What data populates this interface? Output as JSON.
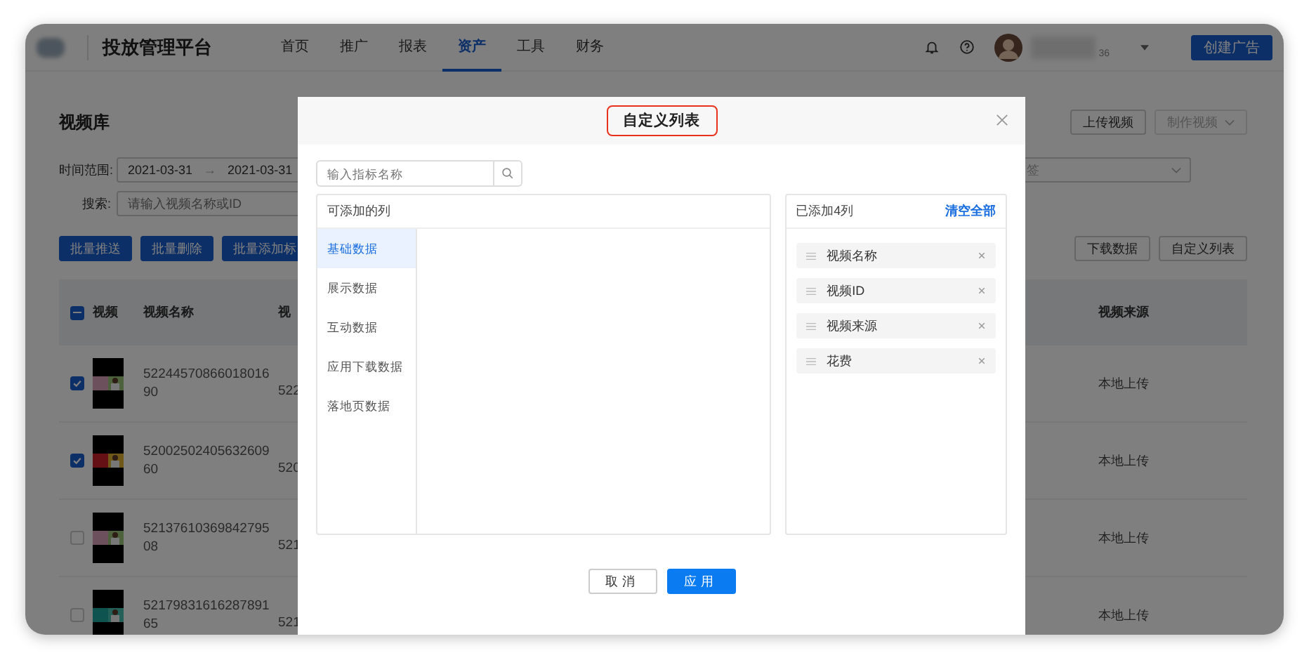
{
  "top_nav": {
    "app_title": "投放管理平台",
    "nav_items": [
      {
        "label": "首页",
        "selected": false
      },
      {
        "label": "推广",
        "selected": false
      },
      {
        "label": "报表",
        "selected": false
      },
      {
        "label": "资产",
        "selected": true
      },
      {
        "label": "工具",
        "selected": false
      },
      {
        "label": "财务",
        "selected": false
      }
    ],
    "user_suffix": "36",
    "create_button": "创建广告"
  },
  "page": {
    "title": "视频库",
    "header_buttons": [
      {
        "label": "上传视频",
        "disabled": false,
        "dropdown": false
      },
      {
        "label": "制作视频",
        "disabled": true,
        "dropdown": true
      }
    ],
    "date_label": "时间范围:",
    "date_start": "2021-03-31",
    "date_separator": "→",
    "date_end": "2021-03-31",
    "search_label": "搜索:",
    "search_placeholder": "请输入视频名称或ID",
    "tag_select_placeholder": "签",
    "batch_buttons": [
      "批量推送",
      "批量删除",
      "批量添加标"
    ],
    "table_buttons": [
      "下载数据",
      "自定义列表"
    ]
  },
  "table": {
    "header_indeterminate": true,
    "columns": [
      "视频",
      "视频名称",
      "视",
      "视频来源"
    ],
    "rows": [
      {
        "checked": true,
        "name": "5224457086601801690",
        "column_4": "522",
        "source": "本地上传"
      },
      {
        "checked": true,
        "name": "5200250240563260960",
        "column_4": "520",
        "source": "本地上传"
      },
      {
        "checked": false,
        "name": "5213761036984279508",
        "column_4": "521",
        "source": "本地上传"
      },
      {
        "checked": false,
        "name": "5217983161628789165",
        "column_4": "521",
        "source": "本地上传"
      }
    ]
  },
  "modal": {
    "title": "自定义列表",
    "search_placeholder": "输入指标名称",
    "available_header": "可添加的列",
    "categories": [
      {
        "label": "基础数据",
        "selected": true
      },
      {
        "label": "展示数据",
        "selected": false
      },
      {
        "label": "互动数据",
        "selected": false
      },
      {
        "label": "应用下载数据",
        "selected": false
      },
      {
        "label": "落地页数据",
        "selected": false
      }
    ],
    "added_header": "已添加4列",
    "clear_all": "清空全部",
    "added_columns": [
      "视频名称",
      "视频ID",
      "视频来源",
      "花费"
    ],
    "cancel": "取消",
    "apply": "应用"
  }
}
